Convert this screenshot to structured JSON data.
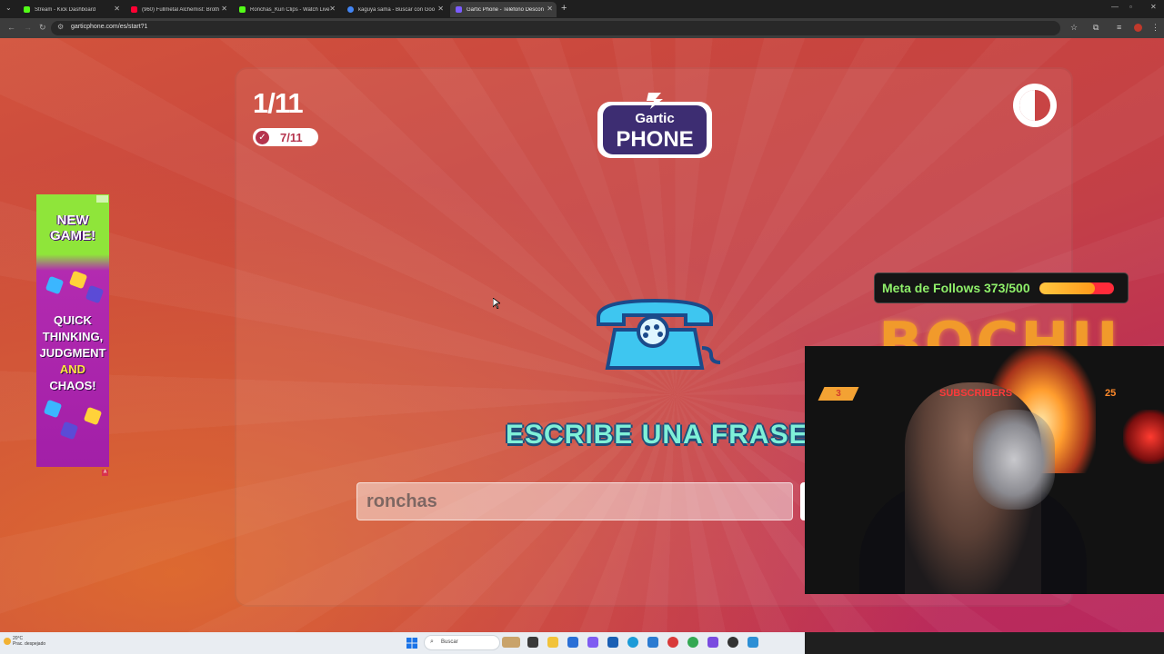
{
  "browser": {
    "tabs": [
      {
        "label": "Stream - Kick Dashboard",
        "color": "#53fc18",
        "active": false
      },
      {
        "label": "(960) Fullmetal Alchemist: Broth",
        "color": "#ff0033",
        "active": false
      },
      {
        "label": "Ronchas_Kun Clips - Watch Live",
        "color": "#53fc18",
        "active": false
      },
      {
        "label": "kaguya sama - Buscar con Goo",
        "color": "#4285f4",
        "active": false
      },
      {
        "label": "Gartic Phone - Teléfono Descon",
        "color": "#7b5cff",
        "active": true
      }
    ],
    "new_tab_glyph": "+",
    "url": "garticphone.com/es/start?1"
  },
  "game": {
    "round": "1/11",
    "completed": "7/11",
    "logo_line1": "Gartic",
    "logo_line2": "PHONE",
    "prompt": "ESCRIBE UNA FRASE",
    "phrase_value": "ronchas"
  },
  "ad": {
    "line1": "NEW",
    "line2": "GAME!",
    "lines": [
      "QUICK",
      "THINKING,",
      "JUDGMENT"
    ],
    "and": "AND",
    "last": "CHAOS!",
    "tag": "A"
  },
  "overlay": {
    "goal_label": "Meta de Follows 373/500",
    "goal_current": 373,
    "goal_total": 500,
    "brand": "BOCHU",
    "subs_count": "3",
    "subs_title": "SUBSCRIBERS",
    "subs_goal": "25"
  },
  "taskbar": {
    "weather_temp": "20°C",
    "weather_desc": "Prac. despejado",
    "search_label": "Buscar"
  },
  "colors": {
    "accent_red": "#b5344d",
    "prompt_text": "#7ff0d8",
    "goal_text": "#8ff06a",
    "brand_orange": "#f19a2b"
  }
}
